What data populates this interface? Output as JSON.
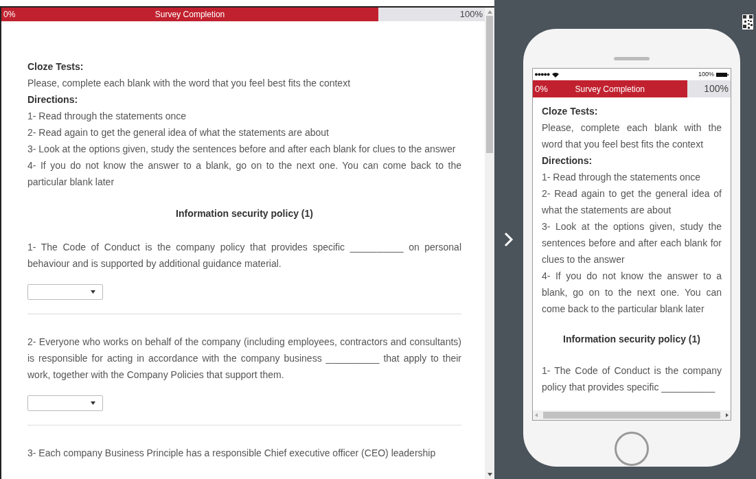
{
  "progress": {
    "start_label": "0%",
    "title": "Survey Completion",
    "end_label": "100%",
    "level": 0.78
  },
  "intro": {
    "heading": "Cloze Tests:",
    "text": "Please, complete each blank with the word that you feel best fits the context",
    "directions_heading": "Directions:",
    "directions": [
      "1- Read through the statements once",
      "2- Read again to get the general idea of what the statements are about",
      "3- Look at the options given, study the sentences before and after each blank for clues to the answer",
      "4- If you do not know the answer to a blank, go on to the next one. You can come back to the particular blank later"
    ]
  },
  "section_title": "Information security policy (1)",
  "questions": [
    {
      "kind": "dropdown",
      "text": "1- The Code of Conduct is the company policy that provides specific __________ on personal behaviour and is supported by additional guidance material."
    },
    {
      "kind": "dropdown",
      "text": "2- Everyone who works on behalf of the company (including employees, contractors and consultants) is responsible for acting in accordance with the company business __________ that apply to their work, together with the Company Policies that support them."
    },
    {
      "kind": "text",
      "text": "3- Each company Business Principle has a responsible Chief executive officer (CEO) leadership"
    }
  ],
  "mobile_preview": {
    "battery_label": "100%",
    "progress": {
      "start_label": "0%",
      "title": "Survey Completion",
      "end_label": "100%",
      "level": 0.78
    },
    "intro": {
      "heading": "Cloze Tests:",
      "text": "Please, complete each blank with the word that you feel best fits the context",
      "directions_heading": "Directions:",
      "directions": [
        "1- Read through the statements once",
        "2- Read again to get the general idea of what the statements are about",
        "3- Look at the options given, study the sentences before and after each blank for clues to the answer",
        "4- If you do not know the answer to a blank, go on to the next one. You can come back to the particular blank later"
      ]
    },
    "section_title": "Information security policy (1)",
    "question_text": "1- The Code of Conduct is the company policy that provides specific __________"
  }
}
